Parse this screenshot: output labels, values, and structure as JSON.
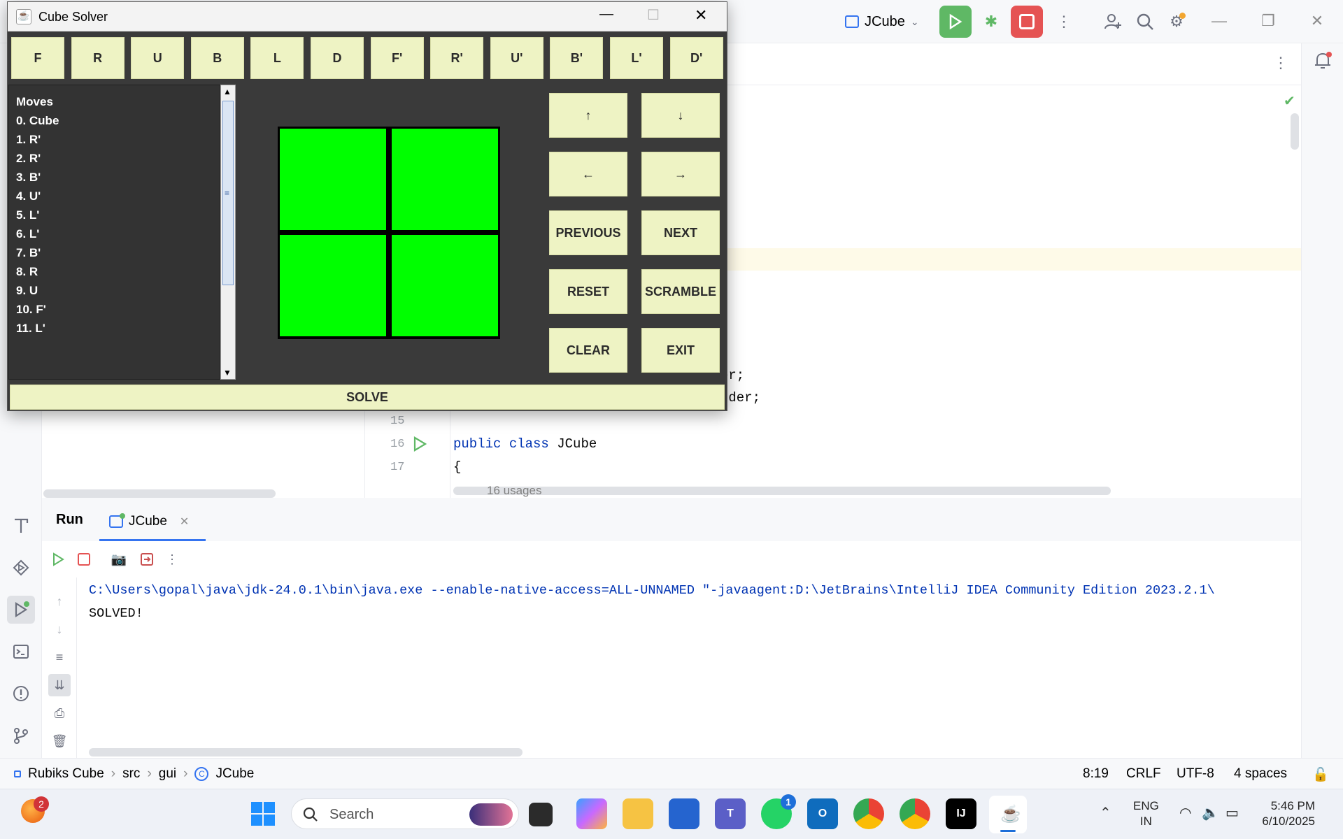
{
  "ide": {
    "run_config": "JCube",
    "window_controls": [
      "minimize",
      "restore",
      "close"
    ]
  },
  "editor": {
    "lines": [
      {
        "num": "15",
        "code": ""
      },
      {
        "num": "16",
        "code": "public class JCube"
      },
      {
        "num": "17",
        "code": "{"
      }
    ],
    "partial_lines": [
      "er;",
      "rder;"
    ],
    "usages_hint": "16 usages"
  },
  "run_panel": {
    "tabs": [
      {
        "label": "Run"
      },
      {
        "label": "JCube"
      }
    ],
    "console": [
      {
        "text": "C:\\Users\\gopal\\java\\jdk-24.0.1\\bin\\java.exe --enable-native-access=ALL-UNNAMED \"-javaagent:D:\\JetBrains\\IntelliJ IDEA Community Edition 2023.2.1\\",
        "color": "#0033b3"
      },
      {
        "text": "SOLVED!",
        "color": "#080808"
      }
    ]
  },
  "status_bar": {
    "breadcrumbs": [
      "Rubiks Cube",
      "src",
      "gui",
      "JCube"
    ],
    "position": "8:19",
    "line_sep": "CRLF",
    "encoding": "UTF-8",
    "indent": "4 spaces"
  },
  "taskbar": {
    "search_placeholder": "Search",
    "language": "ENG",
    "region": "IN",
    "time": "5:46 PM",
    "date": "6/10/2025",
    "notification_badge": "2",
    "whatsapp_badge": "1"
  },
  "cube_solver": {
    "title": "Cube Solver",
    "move_buttons": [
      "F",
      "R",
      "U",
      "B",
      "L",
      "D",
      "F'",
      "R'",
      "U'",
      "B'",
      "L'",
      "D'"
    ],
    "moves_header": "Moves",
    "moves": [
      "0. Cube",
      "1. R'",
      "2. R'",
      "3. B'",
      "4. U'",
      "5. L'",
      "6. L'",
      "7. B'",
      "8. R",
      "9. U",
      "10. F'",
      "11. L'"
    ],
    "nav_buttons": {
      "up": "↑",
      "down": "↓",
      "left": "←",
      "right": "→",
      "previous": "PREVIOUS",
      "next": "NEXT",
      "reset": "RESET",
      "scramble": "SCRAMBLE",
      "clear": "CLEAR",
      "exit": "EXIT"
    },
    "solve": "SOLVE",
    "face_color": "#00ff00"
  }
}
